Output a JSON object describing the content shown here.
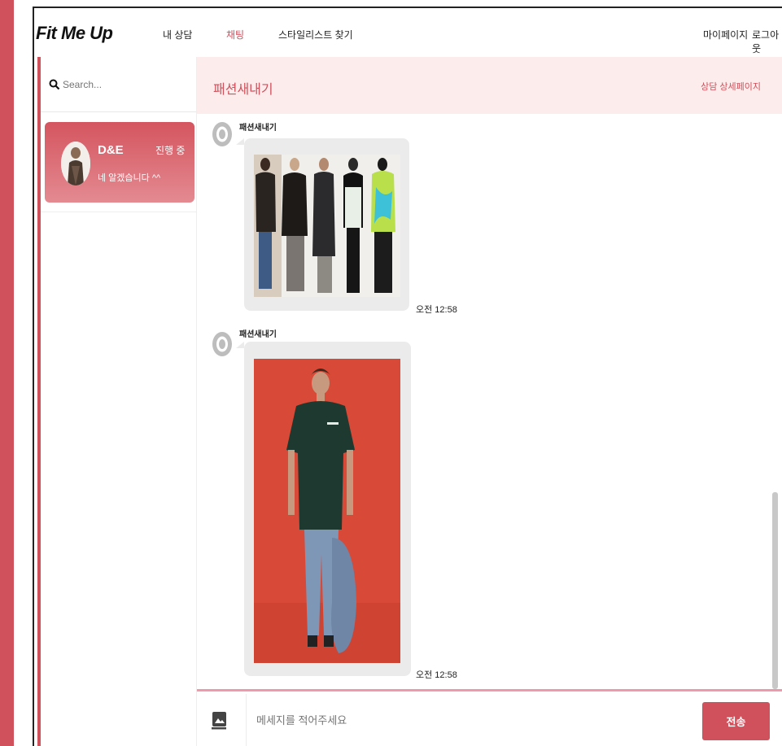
{
  "nav": {
    "logo": "Fit Me Up",
    "items": [
      "내 상담",
      "채팅",
      "스타일리스트 찾기"
    ],
    "right": [
      "마이페이지",
      "로그아웃"
    ]
  },
  "search": {
    "placeholder": "Search..."
  },
  "chat_list": [
    {
      "name": "D&E",
      "status": "진행 중",
      "last_message": "네 알겠습니다 ^^"
    }
  ],
  "chat_header": {
    "title": "패션새내기",
    "detail_link": "상담 상세페이지"
  },
  "messages": [
    {
      "sender": "패션새내기",
      "time": "오전 12:58"
    },
    {
      "sender": "패션새내기",
      "time": "오전 12:58"
    }
  ],
  "composer": {
    "placeholder": "메세지를 적어주세요",
    "send_label": "전송"
  },
  "colors": {
    "accent": "#d0505b",
    "header_bg": "#fdecec",
    "bubble": "#ebebeb",
    "composer_border": "#ef9aab"
  }
}
